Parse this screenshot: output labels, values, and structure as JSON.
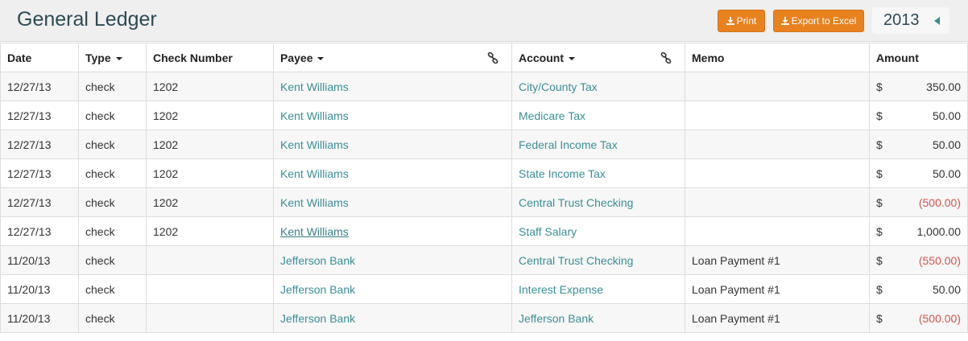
{
  "header": {
    "title": "General Ledger",
    "print_label": "Print",
    "export_label": "Export to Excel",
    "year": "2013",
    "button_color": "#e8821f",
    "link_color": "#3b8e95",
    "negative_color": "#d9534f"
  },
  "table": {
    "columns": {
      "date": "Date",
      "type": "Type",
      "check_number": "Check Number",
      "payee": "Payee",
      "account": "Account",
      "memo": "Memo",
      "amount": "Amount"
    },
    "rows": [
      {
        "date": "12/27/13",
        "type": "check",
        "check_number": "1202",
        "payee": "Kent Williams",
        "account": "City/County Tax",
        "memo": "",
        "currency": "$",
        "amount": "350.00",
        "negative": false,
        "payee_underlined": false
      },
      {
        "date": "12/27/13",
        "type": "check",
        "check_number": "1202",
        "payee": "Kent Williams",
        "account": "Medicare Tax",
        "memo": "",
        "currency": "$",
        "amount": "50.00",
        "negative": false,
        "payee_underlined": false
      },
      {
        "date": "12/27/13",
        "type": "check",
        "check_number": "1202",
        "payee": "Kent Williams",
        "account": "Federal Income Tax",
        "memo": "",
        "currency": "$",
        "amount": "50.00",
        "negative": false,
        "payee_underlined": false
      },
      {
        "date": "12/27/13",
        "type": "check",
        "check_number": "1202",
        "payee": "Kent Williams",
        "account": "State Income Tax",
        "memo": "",
        "currency": "$",
        "amount": "50.00",
        "negative": false,
        "payee_underlined": false
      },
      {
        "date": "12/27/13",
        "type": "check",
        "check_number": "1202",
        "payee": "Kent Williams",
        "account": "Central Trust Checking",
        "memo": "",
        "currency": "$",
        "amount": "(500.00)",
        "negative": true,
        "payee_underlined": false
      },
      {
        "date": "12/27/13",
        "type": "check",
        "check_number": "1202",
        "payee": "Kent Williams",
        "account": "Staff Salary",
        "memo": "",
        "currency": "$",
        "amount": "1,000.00",
        "negative": false,
        "payee_underlined": true
      },
      {
        "date": "11/20/13",
        "type": "check",
        "check_number": "",
        "payee": "Jefferson Bank",
        "account": "Central Trust Checking",
        "memo": "Loan Payment #1",
        "currency": "$",
        "amount": "(550.00)",
        "negative": true,
        "payee_underlined": false
      },
      {
        "date": "11/20/13",
        "type": "check",
        "check_number": "",
        "payee": "Jefferson Bank",
        "account": "Interest Expense",
        "memo": "Loan Payment #1",
        "currency": "$",
        "amount": "50.00",
        "negative": false,
        "payee_underlined": false
      },
      {
        "date": "11/20/13",
        "type": "check",
        "check_number": "",
        "payee": "Jefferson Bank",
        "account": "Jefferson Bank",
        "memo": "Loan Payment #1",
        "currency": "$",
        "amount": "(500.00)",
        "negative": true,
        "payee_underlined": false
      }
    ]
  }
}
